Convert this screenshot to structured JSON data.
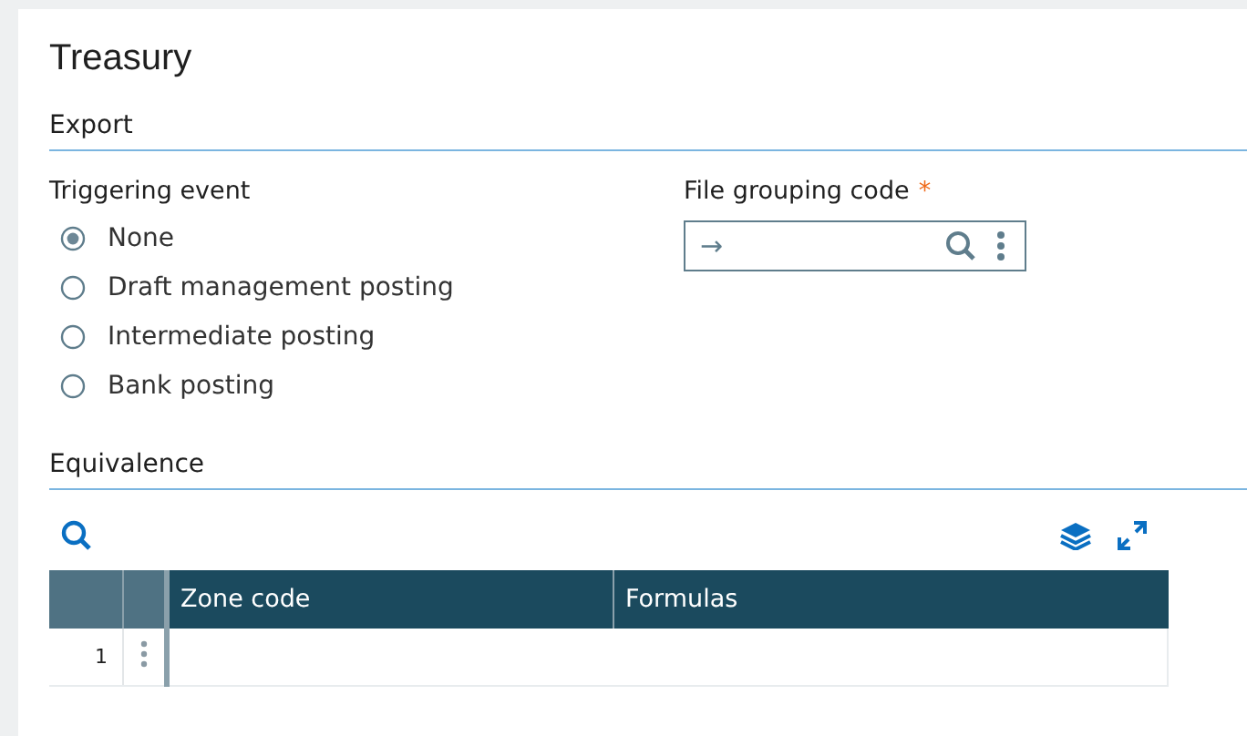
{
  "title": "Treasury",
  "export": {
    "heading": "Export",
    "triggering_event": {
      "label": "Triggering event",
      "options": [
        {
          "label": "None",
          "selected": true
        },
        {
          "label": "Draft management posting",
          "selected": false
        },
        {
          "label": "Intermediate posting",
          "selected": false
        },
        {
          "label": "Bank posting",
          "selected": false
        }
      ]
    },
    "file_grouping_code": {
      "label": "File grouping code",
      "required_mark": "*",
      "arrow": "→"
    }
  },
  "equivalence": {
    "heading": "Equivalence",
    "table": {
      "columns": [
        "Zone code",
        "Formulas"
      ],
      "rows": [
        {
          "number": "1"
        }
      ]
    }
  }
}
